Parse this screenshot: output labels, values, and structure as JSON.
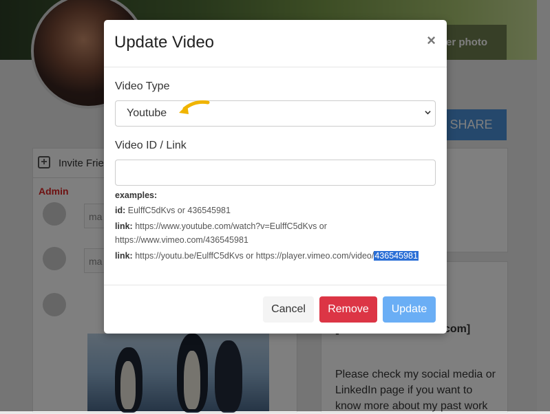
{
  "background": {
    "cover_button_label": "er photo",
    "share_label": "SHARE",
    "invite_label": "Invite Frie",
    "feed_placeholder_1": "ma",
    "feed_placeholder_2": "ma",
    "admin_name": "Admin",
    "right_bold_1": "[",
    "right_bold_2": "com]",
    "right_text": "Please check my social media or LinkedIn page if you want to know more about my past work"
  },
  "modal": {
    "title": "Update Video",
    "close_glyph": "×",
    "video_type_label": "Video Type",
    "video_type_selected": "Youtube",
    "video_id_label": "Video ID / Link",
    "video_id_value": "",
    "examples_heading": "examples:",
    "id_label": "id:",
    "id_example": "EulffC5dKvs or 436545981",
    "link_label": "link:",
    "link_example_1a": "https://www.youtube.com/watch?v=EulffC5dKvs or",
    "link_example_1b": "https://www.vimeo.com/436545981",
    "link_label_2": "link:",
    "link_example_2": "https://youtu.be/EulffC5dKvs or https://player.vimeo.com/video/",
    "link_example_2_highlight": "436545981",
    "buttons": {
      "cancel": "Cancel",
      "remove": "Remove",
      "update": "Update"
    }
  },
  "colors": {
    "remove": "#dc3545",
    "update": "#6aaef5",
    "arrow": "#f0b400",
    "highlight": "#2a6fd6"
  }
}
